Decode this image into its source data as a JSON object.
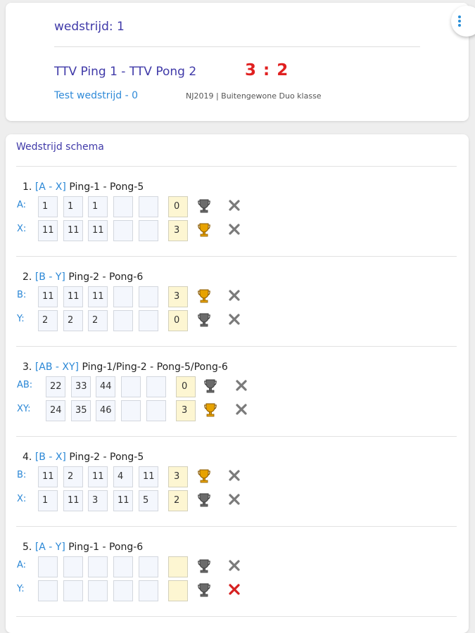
{
  "header": {
    "match_title": "wedstrijd: 1",
    "teams": "TTV Ping 1 - TTV Pong 2",
    "score": "3 : 2",
    "test_link": "Test wedstrijd - 0",
    "meta": "NJ2019 | Buitengewone Duo klasse",
    "menu_icon": "more-vertical-icon"
  },
  "schema": {
    "title": "Wedstrijd schema",
    "games": [
      {
        "number": "1.",
        "code": "[A - X]",
        "players": "Ping-1 - Pong-5",
        "rows": [
          {
            "label": "A:",
            "sets": [
              "1",
              "1",
              "1",
              "",
              ""
            ],
            "total": "0",
            "winner": false,
            "delete_active": false
          },
          {
            "label": "X:",
            "sets": [
              "11",
              "11",
              "11",
              "",
              ""
            ],
            "total": "3",
            "winner": true,
            "delete_active": false
          }
        ]
      },
      {
        "number": "2.",
        "code": "[B - Y]",
        "players": "Ping-2 - Pong-6",
        "rows": [
          {
            "label": "B:",
            "sets": [
              "11",
              "11",
              "11",
              "",
              ""
            ],
            "total": "3",
            "winner": true,
            "delete_active": false
          },
          {
            "label": "Y:",
            "sets": [
              "2",
              "2",
              "2",
              "",
              ""
            ],
            "total": "0",
            "winner": false,
            "delete_active": false
          }
        ]
      },
      {
        "number": "3.",
        "code": "[AB - XY]",
        "players": "Ping-1/Ping-2 - Pong-5/Pong-6",
        "rows": [
          {
            "label": "AB:",
            "sets": [
              "22",
              "33",
              "44",
              "",
              ""
            ],
            "total": "0",
            "winner": false,
            "delete_active": false
          },
          {
            "label": "XY:",
            "sets": [
              "24",
              "35",
              "46",
              "",
              ""
            ],
            "total": "3",
            "winner": true,
            "delete_active": false
          }
        ]
      },
      {
        "number": "4.",
        "code": "[B - X]",
        "players": "Ping-2 - Pong-5",
        "rows": [
          {
            "label": "B:",
            "sets": [
              "11",
              "2",
              "11",
              "4",
              "11"
            ],
            "total": "3",
            "winner": true,
            "delete_active": false
          },
          {
            "label": "X:",
            "sets": [
              "1",
              "11",
              "3",
              "11",
              "5"
            ],
            "total": "2",
            "winner": false,
            "delete_active": false
          }
        ]
      },
      {
        "number": "5.",
        "code": "[A - Y]",
        "players": "Ping-1 - Pong-6",
        "rows": [
          {
            "label": "A:",
            "sets": [
              "",
              "",
              "",
              "",
              ""
            ],
            "total": "",
            "winner": false,
            "delete_active": false
          },
          {
            "label": "Y:",
            "sets": [
              "",
              "",
              "",
              "",
              ""
            ],
            "total": "",
            "winner": false,
            "delete_active": true
          }
        ]
      }
    ]
  },
  "colors": {
    "title_purple": "#3f39a8",
    "link_blue": "#2a87d6",
    "score_red": "#e02020",
    "trophy_gold": "#e7a200",
    "trophy_gray": "#6b6b6b",
    "x_gray": "#7a7a7a",
    "x_red": "#d62020"
  },
  "icons": {
    "trophy": "trophy-icon",
    "delete": "close-icon"
  }
}
